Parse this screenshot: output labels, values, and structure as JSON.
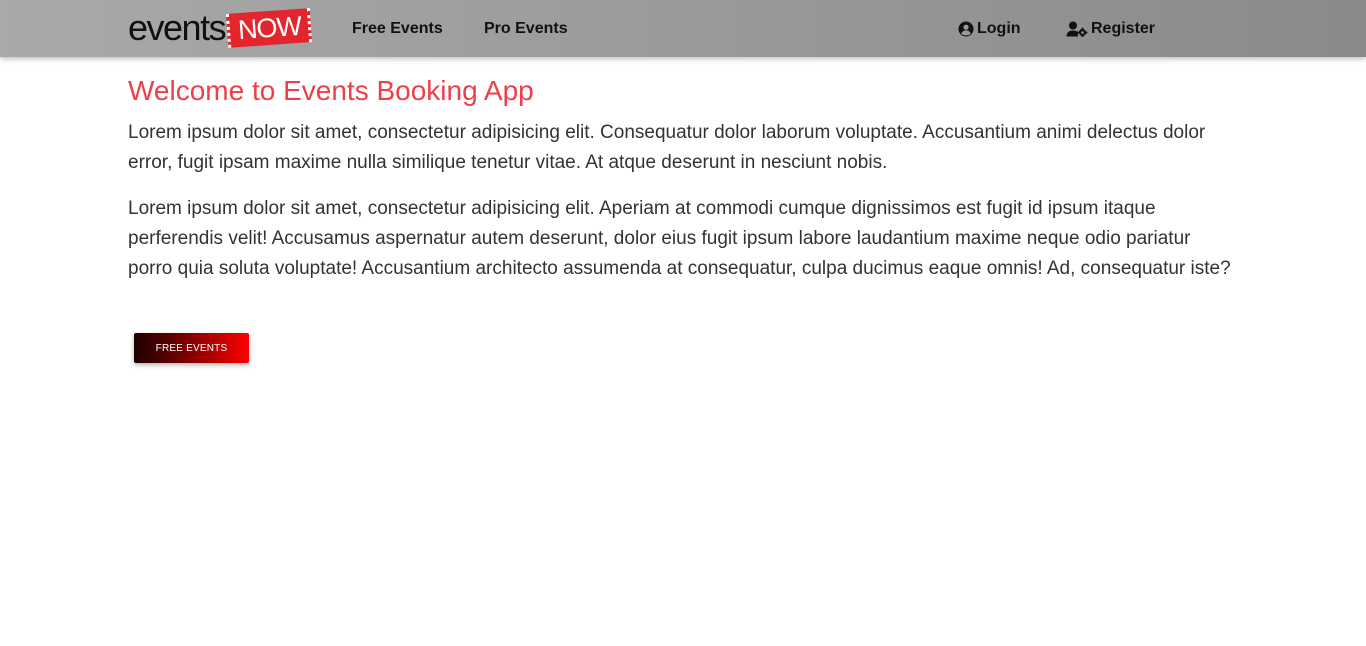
{
  "navbar": {
    "logo": {
      "events_text": "events",
      "now_text": "NOW"
    },
    "links": {
      "free_events": "Free Events",
      "pro_events": "Pro Events",
      "login": "Login",
      "register": "Register"
    },
    "icons": {
      "login": "user-circle-icon",
      "register": "user-cog-icon"
    }
  },
  "main": {
    "title": "Welcome to Events Booking App",
    "paragraph1": "Lorem ipsum dolor sit amet, consectetur adipisicing elit. Consequatur dolor laborum voluptate. Accusantium animi delectus dolor error, fugit ipsam maxime nulla similique tenetur vitae. At atque deserunt in nesciunt nobis.",
    "paragraph2": "Lorem ipsum dolor sit amet, consectetur adipisicing elit. Aperiam at commodi cumque dignissimos est fugit id ipsum itaque perferendis velit! Accusamus aspernatur autem deserunt, dolor eius fugit ipsum labore laudantium maxime neque odio pariatur porro quia soluta voluptate! Accusantium architecto assumenda at consequatur, culpa ducimus eaque omnis! Ad, consequatur iste?",
    "button_label": "FREE EVENTS"
  },
  "colors": {
    "title": "#ef3e4a",
    "logo_badge": "#e3262e",
    "navbar": "#9a9a9a",
    "button_start": "#1c0000",
    "button_end": "#ff0000"
  }
}
